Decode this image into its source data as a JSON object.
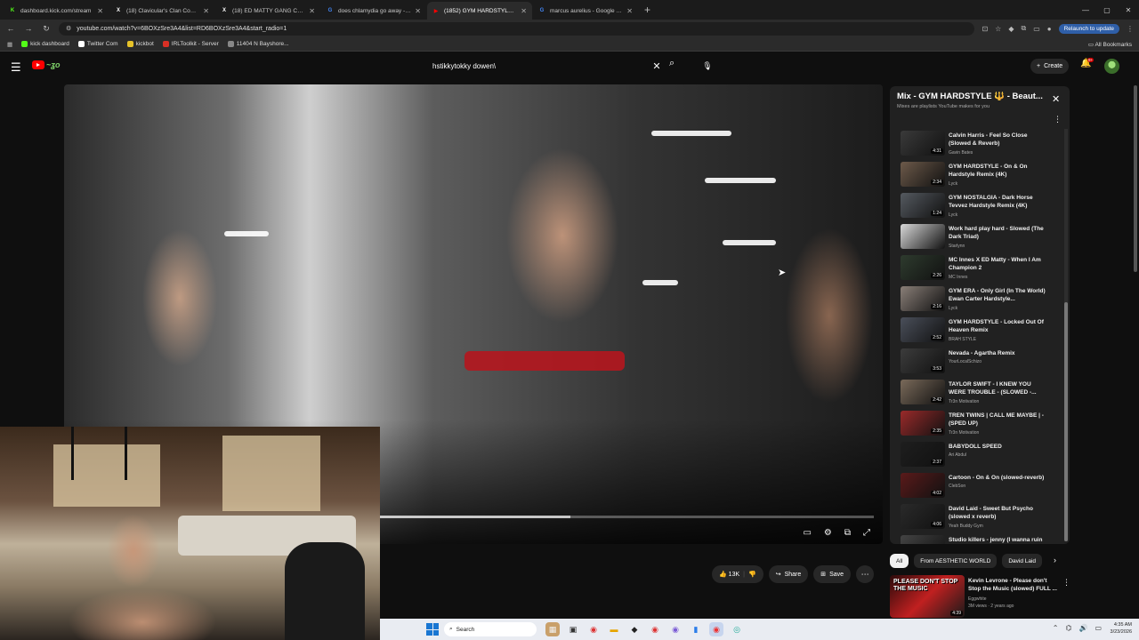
{
  "browser": {
    "tabs": [
      {
        "label": "dashboard.kick.com/stream",
        "favicon_color": "#53fc18",
        "favicon_glyph": "K",
        "active": false
      },
      {
        "label": "(18) Clavicular's Clan Commun",
        "favicon_color": "#ffffff",
        "favicon_glyph": "X",
        "active": false
      },
      {
        "label": "(18) ED MATTY GANG Commu",
        "favicon_color": "#ffffff",
        "favicon_glyph": "X",
        "active": false
      },
      {
        "label": "does chlamydia go away - Goo",
        "favicon_color": "#4285f4",
        "favicon_glyph": "G",
        "active": false
      },
      {
        "label": "(1852) GYM HARDSTYLE 🔱 - B",
        "favicon_color": "#ff0000",
        "favicon_glyph": "▶",
        "active": true
      },
      {
        "label": "marcus aurelius - Google Sear",
        "favicon_color": "#4285f4",
        "favicon_glyph": "G",
        "active": false
      }
    ],
    "url": "youtube.com/watch?v=6BOXzSre3A4&list=RD6BOXzSre3A4&start_radio=1",
    "relaunch_label": "Relaunch to update",
    "bookmarks": [
      {
        "label": "kick dashboard",
        "color": "#53fc18"
      },
      {
        "label": "Twitter Com",
        "color": "#ffffff"
      },
      {
        "label": "kickbot",
        "color": "#e6c229"
      },
      {
        "label": "IRLToolkit - Server",
        "color": "#d93025"
      },
      {
        "label": "11404 N Bayshore...",
        "color": "#888888"
      }
    ],
    "all_bookmarks_label": "All Bookmarks"
  },
  "youtube": {
    "search": {
      "value": "hstikkytokky dowen\\"
    },
    "create_label": "Create",
    "notif_badge": "9+"
  },
  "player": {
    "progress_fraction": 0.385
  },
  "actions": {
    "like_count": "13K",
    "share_label": "Share",
    "save_label": "Save"
  },
  "playlist": {
    "title": "Mix - GYM HARDSTYLE 🔱 - Beaut...",
    "subtitle": "Mixes are playlists YouTube makes for you",
    "scroll_fraction_top": 0.42,
    "scroll_fraction_size": 0.58,
    "items": [
      {
        "title": "Calvin Harris - Feel So Close (Slowed & Reverb)",
        "channel": "Gavin Bates",
        "duration": "4:31",
        "thumb": "#3a3a3a"
      },
      {
        "title": "GYM HARDSTYLE - On & On Hardstyle Remix (4K)",
        "channel": "Lyck",
        "duration": "2:34",
        "thumb": "#6d5a4a"
      },
      {
        "title": "GYM NOSTALGIA - Dark Horse Tevvez Hardstyle Remix (4K)",
        "channel": "Lyck",
        "duration": "1:24",
        "thumb": "#555a60"
      },
      {
        "title": "Work hard play hard - Slowed (The Dark Triad)",
        "channel": "Starlynn",
        "duration": "",
        "thumb": "#d8d8d8"
      },
      {
        "title": "MC Innes X ED Matty - When I Am Champion 2",
        "channel": "MC Innes",
        "duration": "2:26",
        "thumb": "#2e3b2e"
      },
      {
        "title": "GYM ERA - Only Girl (In The World) Ewan Carter Hardstyle...",
        "channel": "Lyck",
        "duration": "2:16",
        "thumb": "#8a7f78"
      },
      {
        "title": "GYM HARDSTYLE - Locked Out Of Heaven Remix",
        "channel": "BRAH STYLE",
        "duration": "2:52",
        "thumb": "#4a4f5a"
      },
      {
        "title": "Nevada - Agartha Remix",
        "channel": "YourLocalSchizo",
        "duration": "3:53",
        "thumb": "#3c3c3c"
      },
      {
        "title": "TAYLOR SWIFT - I KNEW YOU WERE TROUBLE - (SLOWED -...",
        "channel": "Tr3n Motivation",
        "duration": "2:42",
        "thumb": "#7a6a5a"
      },
      {
        "title": "TREN TWINS | CALL ME MAYBE | - (SPED UP)",
        "channel": "Tr3n Motivation",
        "duration": "2:35",
        "thumb": "#9a2a2a"
      },
      {
        "title": "BABYDOLL SPEED",
        "channel": "Ari Abdul",
        "duration": "2:37",
        "thumb": "#1e1e1e"
      },
      {
        "title": "Cartoon - On & On (slowed-reverb)",
        "channel": "ClebSon",
        "duration": "4:02",
        "thumb": "#5a1a1a"
      },
      {
        "title": "David Laid - Sweet But Psycho (slowed x reverb)",
        "channel": "Yeah Buddy Gym",
        "duration": "4:06",
        "thumb": "#2a2a2a"
      },
      {
        "title": "Studio killers - jenny (I wanna ruin our friendship) Slowed...",
        "channel": "",
        "duration": "",
        "thumb": "#444444"
      }
    ]
  },
  "chips": {
    "items": [
      "All",
      "From AESTHETIC WORLD",
      "David Laid"
    ]
  },
  "recommended": {
    "thumb_text": "PLEASE DON'T STOP THE MUSIC",
    "title": "Kevin Levrone - Please don't Stop the Music (slowed) FULL ...",
    "channel": "Eggwhite",
    "meta": "3M views · 2 years ago",
    "duration": "4:39"
  },
  "taskbar": {
    "search_placeholder": "Search",
    "time": "4:35 AM",
    "date": "3/23/2026"
  }
}
